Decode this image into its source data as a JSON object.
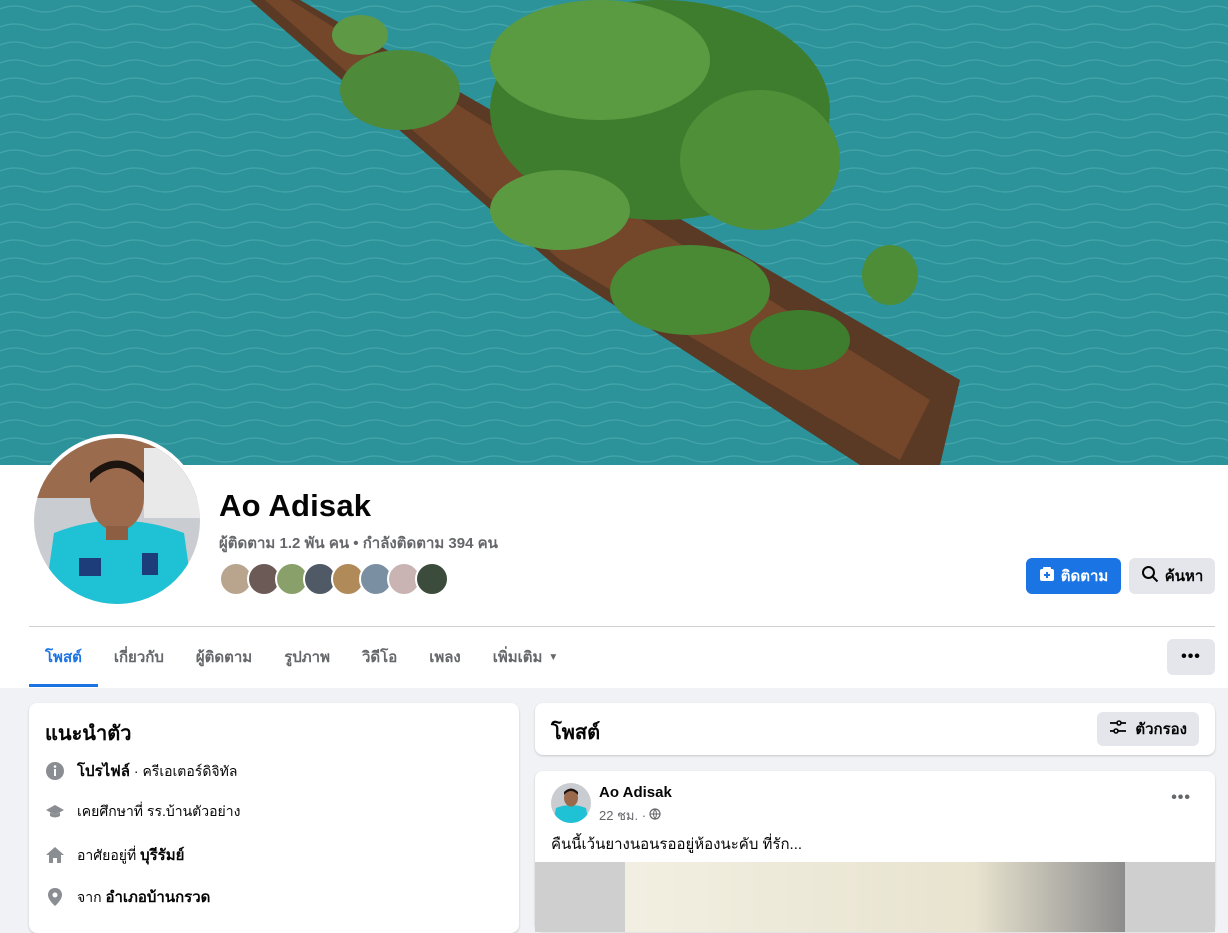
{
  "profile": {
    "name": "Ao Adisak",
    "stats": "ผู้ติดตาม 1.2 พัน คน • กำลังติดตาม 394 คน",
    "follow_label": "ติดตาม",
    "search_label": "ค้นหา",
    "friend_avatar_count": 8
  },
  "tabs": {
    "posts": "โพสต์",
    "about": "เกี่ยวกับ",
    "followers": "ผู้ติดตาม",
    "photos": "รูปภาพ",
    "videos": "วิดีโอ",
    "music": "เพลง",
    "more": "เพิ่มเติม",
    "more_caret": "▼",
    "overflow": "•••"
  },
  "intro": {
    "title": "แนะนำตัว",
    "profile_prefix": "โปรไฟล์",
    "profile_category": " · ครีเอเตอร์ดิจิทัล",
    "education": "เคยศึกษาที่ รร.บ้านตัวอย่าง",
    "lives_prefix": "อาศัยอยู่ที่ ",
    "lives_place": "บุรีรัมย์",
    "from_prefix": "จาก ",
    "from_place": "อำเภอบ้านกรวด"
  },
  "posts_section": {
    "title": "โพสต์",
    "filter_label": "ตัวกรอง"
  },
  "post": {
    "author": "Ao Adisak",
    "time": "22 ชม. ·",
    "text": "คืนนี้เว้นยางนอนรออยู่ห้องนะคับ ที่รัก...",
    "more": "•••"
  },
  "colors": {
    "accent": "#1b74e4",
    "secondary_text": "#65676b",
    "page_bg": "#f0f2f5"
  }
}
